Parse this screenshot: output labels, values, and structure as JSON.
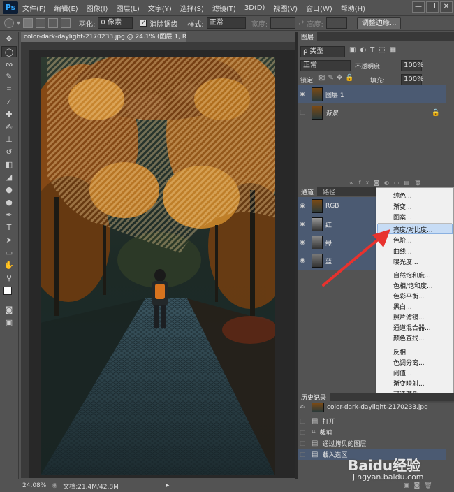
{
  "app": {
    "logo": "Ps"
  },
  "menu": [
    "文件(F)",
    "编辑(E)",
    "图像(I)",
    "图层(L)",
    "文字(Y)",
    "选择(S)",
    "滤镜(T)",
    "3D(D)",
    "视图(V)",
    "窗口(W)",
    "帮助(H)"
  ],
  "window_controls": {
    "minimize": "—",
    "restore": "❐",
    "close": "✕"
  },
  "options": {
    "feather_label": "羽化:",
    "feather_value": "0 像素",
    "antialias_label": "消除锯齿",
    "antialias_checked": true,
    "style_label": "样式:",
    "style_value": "正常",
    "width_label": "宽度:",
    "height_label": "高度:",
    "refine_edge_button": "调整边缘..."
  },
  "document": {
    "tab_title": "color-dark-daylight-2170233.jpg @ 24.1% (图层 1, RGB/8) *",
    "tab_close": "×",
    "zoom": "24.08%",
    "doc_info": "文档:21.4M/42.8M"
  },
  "layers_panel": {
    "tab": "图层",
    "kind_filter": "ρ 类型",
    "blend_mode": "正常",
    "opacity_label": "不透明度:",
    "opacity_value": "100%",
    "lock_label": "锁定:",
    "fill_label": "填充:",
    "fill_value": "100%",
    "layers": [
      {
        "name": "图层 1",
        "selected": true,
        "visible": true
      },
      {
        "name": "背景",
        "selected": false,
        "visible": false,
        "locked": true
      }
    ]
  },
  "channels_panel": {
    "tabs": [
      "通道",
      "路径"
    ],
    "channels": [
      {
        "name": "RGB"
      },
      {
        "name": "红"
      },
      {
        "name": "绿"
      },
      {
        "name": "蓝"
      }
    ]
  },
  "adjustment_menu": {
    "groups": [
      [
        "纯色...",
        "渐变...",
        "图案..."
      ],
      [
        "亮度/对比度...",
        "色阶...",
        "曲线...",
        "曝光度..."
      ],
      [
        "自然饱和度...",
        "色相/饱和度...",
        "色彩平衡...",
        "黑白...",
        "照片滤镜...",
        "通道混合器...",
        "颜色查找..."
      ],
      [
        "反相",
        "色调分离...",
        "阈值...",
        "渐变映射...",
        "可选颜色..."
      ]
    ],
    "highlighted": "亮度/对比度..."
  },
  "history_panel": {
    "tab": "历史记录",
    "snapshot": "color-dark-daylight-2170233.jpg",
    "items": [
      "打开",
      "裁剪",
      "通过拷贝的图层",
      "载入选区"
    ],
    "selected": "载入选区"
  },
  "watermark": {
    "text": "Baidu经验",
    "url": "jingyan.baidu.com"
  },
  "colors": {
    "arrow": "#e8322e",
    "selection": "#4b5a72",
    "menu_highlight": "#c7dcf5"
  }
}
